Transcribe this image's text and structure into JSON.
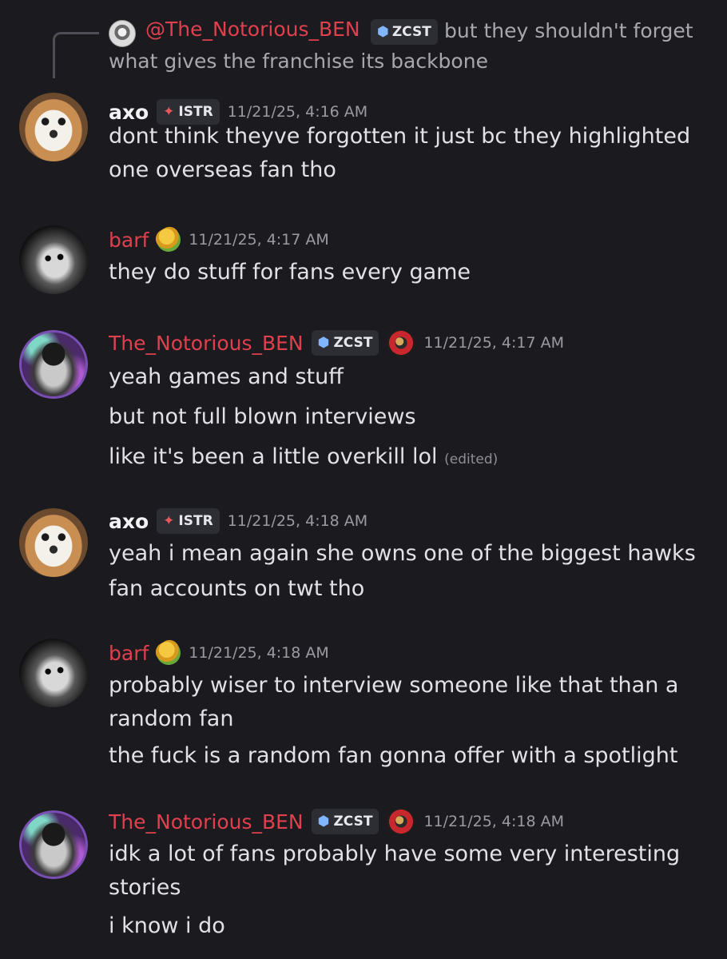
{
  "reply": {
    "mention": "@The_Notorious_BEN",
    "tag_label": "ZCST",
    "text_line1": "but they shouldn't forget",
    "text_line2": "what gives the franchise its backbone"
  },
  "messages": [
    {
      "username": "axo",
      "tag_label": "ISTR",
      "timestamp": "11/21/25, 4:16 AM",
      "lines": [
        "dont think theyve forgotten it just bc they highlighted",
        "one overseas fan tho"
      ]
    },
    {
      "username": "barf",
      "timestamp": "11/21/25, 4:17 AM",
      "lines": [
        "they do stuff for fans every game"
      ]
    },
    {
      "username": "The_Notorious_BEN",
      "tag_label": "ZCST",
      "timestamp": "11/21/25, 4:17 AM",
      "lines": [
        "yeah games and stuff",
        "but not full blown interviews",
        "like it's been a little overkill lol"
      ],
      "edited": "(edited)"
    },
    {
      "username": "axo",
      "tag_label": "ISTR",
      "timestamp": "11/21/25, 4:18 AM",
      "lines": [
        "yeah i mean again she owns one of the biggest hawks",
        "fan accounts on twt tho"
      ]
    },
    {
      "username": "barf",
      "timestamp": "11/21/25, 4:18 AM",
      "lines": [
        "probably wiser to interview someone like that than a",
        "random fan",
        "the fuck is a random fan gonna offer with a spotlight"
      ]
    },
    {
      "username": "The_Notorious_BEN",
      "tag_label": "ZCST",
      "timestamp": "11/21/25, 4:18 AM",
      "lines": [
        "idk a lot of fans probably have some very interesting",
        "stories",
        "i know i do"
      ]
    }
  ],
  "colors": {
    "background": "#1b1b1f",
    "mention_red": "#e0404e",
    "text": "#e2e2e6",
    "muted": "#9a9aa2"
  }
}
